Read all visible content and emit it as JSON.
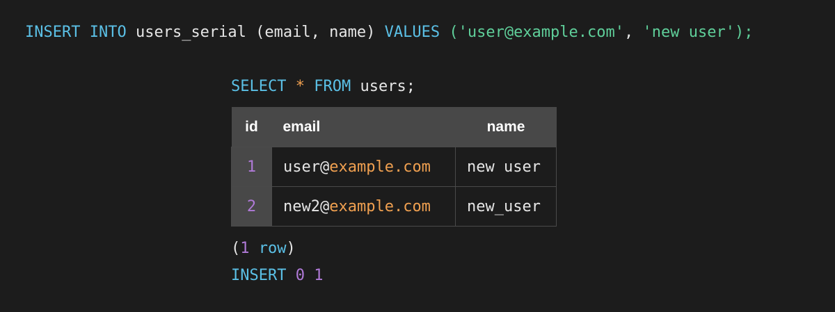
{
  "insert_statement": {
    "kw_insert": "INSERT",
    "kw_into": "INTO",
    "table": "users_serial",
    "columns": "(email, name)",
    "kw_values": "VALUES",
    "open": "(",
    "value_email": "'user@example.com'",
    "comma": ", ",
    "value_name": "'new user'",
    "close": ");"
  },
  "select_statement": {
    "kw_select": "SELECT",
    "star": "*",
    "kw_from": "FROM",
    "table": "users;"
  },
  "result_table": {
    "headers": [
      "id",
      "email",
      "name"
    ],
    "rows": [
      {
        "id": "1",
        "email_local": "user@",
        "email_domain": "example.com",
        "name": "new user"
      },
      {
        "id": "2",
        "email_local": "new2@",
        "email_domain": "example.com",
        "name": "new_user"
      }
    ]
  },
  "row_count": {
    "open": "(",
    "count": "1",
    "word": "row",
    "close": ")"
  },
  "insert_result": {
    "kw": "INSERT",
    "oid": "0",
    "count": "1"
  }
}
